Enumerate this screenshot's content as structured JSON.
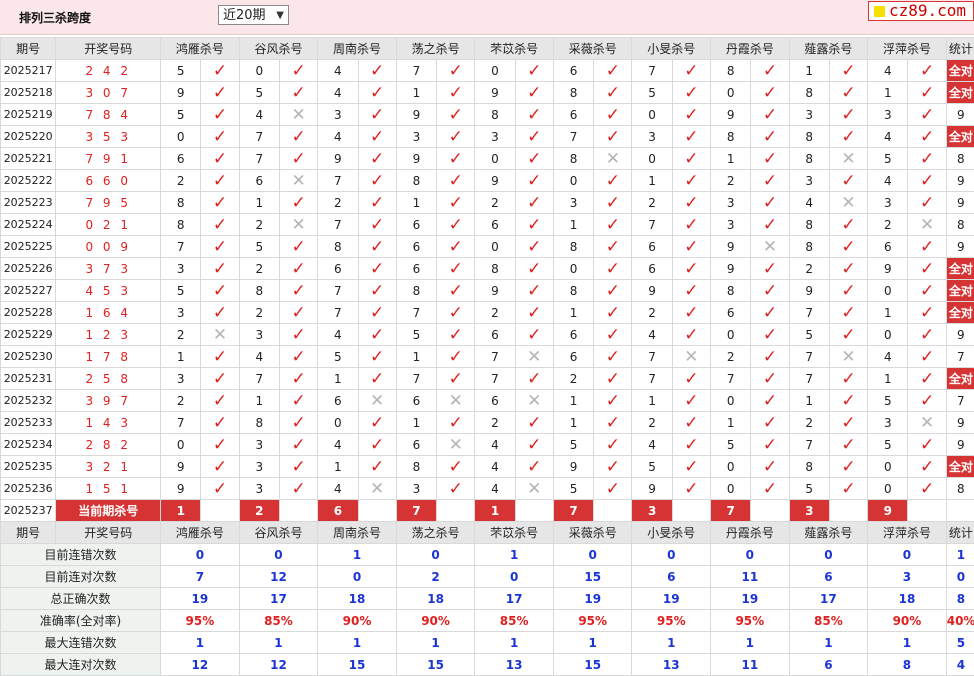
{
  "header": {
    "title": "排列三杀跨度",
    "period_select": "近20期",
    "logo_text": "cz89.com"
  },
  "columns": [
    "期号",
    "开奖号码",
    "鸿雁杀号",
    "谷风杀号",
    "周南杀号",
    "荡之杀号",
    "芣苡杀号",
    "采薇杀号",
    "小旻杀号",
    "丹霞杀号",
    "薤露杀号",
    "浮萍杀号",
    "统计"
  ],
  "rows": [
    {
      "q": "2025217",
      "n": "242",
      "v": [
        5,
        0,
        4,
        7,
        0,
        6,
        7,
        8,
        1,
        4
      ],
      "r": [
        1,
        1,
        1,
        1,
        1,
        1,
        1,
        1,
        1,
        1
      ],
      "s": "全对"
    },
    {
      "q": "2025218",
      "n": "307",
      "v": [
        9,
        5,
        4,
        1,
        9,
        8,
        5,
        0,
        8,
        1
      ],
      "r": [
        1,
        1,
        1,
        1,
        1,
        1,
        1,
        1,
        1,
        1
      ],
      "s": "全对"
    },
    {
      "q": "2025219",
      "n": "784",
      "v": [
        5,
        4,
        3,
        9,
        8,
        6,
        0,
        9,
        3,
        3
      ],
      "r": [
        1,
        0,
        1,
        1,
        1,
        1,
        1,
        1,
        1,
        1
      ],
      "s": "9"
    },
    {
      "q": "2025220",
      "n": "353",
      "v": [
        0,
        7,
        4,
        3,
        3,
        7,
        3,
        8,
        8,
        4
      ],
      "r": [
        1,
        1,
        1,
        1,
        1,
        1,
        1,
        1,
        1,
        1
      ],
      "s": "全对"
    },
    {
      "q": "2025221",
      "n": "791",
      "v": [
        6,
        7,
        9,
        9,
        0,
        8,
        0,
        1,
        8,
        5
      ],
      "r": [
        1,
        1,
        1,
        1,
        1,
        0,
        1,
        1,
        0,
        1
      ],
      "s": "8"
    },
    {
      "q": "2025222",
      "n": "660",
      "v": [
        2,
        6,
        7,
        8,
        9,
        0,
        1,
        2,
        3,
        4
      ],
      "r": [
        1,
        0,
        1,
        1,
        1,
        1,
        1,
        1,
        1,
        1
      ],
      "s": "9"
    },
    {
      "q": "2025223",
      "n": "795",
      "v": [
        8,
        1,
        2,
        1,
        2,
        3,
        2,
        3,
        4,
        3
      ],
      "r": [
        1,
        1,
        1,
        1,
        1,
        1,
        1,
        1,
        0,
        1
      ],
      "s": "9"
    },
    {
      "q": "2025224",
      "n": "021",
      "v": [
        8,
        2,
        7,
        6,
        6,
        1,
        7,
        3,
        8,
        2
      ],
      "r": [
        1,
        0,
        1,
        1,
        1,
        1,
        1,
        1,
        1,
        0
      ],
      "s": "8"
    },
    {
      "q": "2025225",
      "n": "009",
      "v": [
        7,
        5,
        8,
        6,
        0,
        8,
        6,
        9,
        8,
        6
      ],
      "r": [
        1,
        1,
        1,
        1,
        1,
        1,
        1,
        0,
        1,
        1
      ],
      "s": "9"
    },
    {
      "q": "2025226",
      "n": "373",
      "v": [
        3,
        2,
        6,
        6,
        8,
        0,
        6,
        9,
        2,
        9
      ],
      "r": [
        1,
        1,
        1,
        1,
        1,
        1,
        1,
        1,
        1,
        1
      ],
      "s": "全对"
    },
    {
      "q": "2025227",
      "n": "453",
      "v": [
        5,
        8,
        7,
        8,
        9,
        8,
        9,
        8,
        9,
        0
      ],
      "r": [
        1,
        1,
        1,
        1,
        1,
        1,
        1,
        1,
        1,
        1
      ],
      "s": "全对"
    },
    {
      "q": "2025228",
      "n": "164",
      "v": [
        3,
        2,
        7,
        7,
        2,
        1,
        2,
        6,
        7,
        1
      ],
      "r": [
        1,
        1,
        1,
        1,
        1,
        1,
        1,
        1,
        1,
        1
      ],
      "s": "全对"
    },
    {
      "q": "2025229",
      "n": "123",
      "v": [
        2,
        3,
        4,
        5,
        6,
        6,
        4,
        0,
        5,
        0
      ],
      "r": [
        0,
        1,
        1,
        1,
        1,
        1,
        1,
        1,
        1,
        1
      ],
      "s": "9"
    },
    {
      "q": "2025230",
      "n": "178",
      "v": [
        1,
        4,
        5,
        1,
        7,
        6,
        7,
        2,
        7,
        4
      ],
      "r": [
        1,
        1,
        1,
        1,
        0,
        1,
        0,
        1,
        0,
        1
      ],
      "s": "7"
    },
    {
      "q": "2025231",
      "n": "258",
      "v": [
        3,
        7,
        1,
        7,
        7,
        2,
        7,
        7,
        7,
        1
      ],
      "r": [
        1,
        1,
        1,
        1,
        1,
        1,
        1,
        1,
        1,
        1
      ],
      "s": "全对"
    },
    {
      "q": "2025232",
      "n": "397",
      "v": [
        2,
        1,
        6,
        6,
        6,
        1,
        1,
        0,
        1,
        5
      ],
      "r": [
        1,
        1,
        0,
        0,
        0,
        1,
        1,
        1,
        1,
        1
      ],
      "s": "7"
    },
    {
      "q": "2025233",
      "n": "143",
      "v": [
        7,
        8,
        0,
        1,
        2,
        1,
        2,
        1,
        2,
        3
      ],
      "r": [
        1,
        1,
        1,
        1,
        1,
        1,
        1,
        1,
        1,
        0
      ],
      "s": "9"
    },
    {
      "q": "2025234",
      "n": "282",
      "v": [
        0,
        3,
        4,
        6,
        4,
        5,
        4,
        5,
        7,
        5
      ],
      "r": [
        1,
        1,
        1,
        0,
        1,
        1,
        1,
        1,
        1,
        1
      ],
      "s": "9"
    },
    {
      "q": "2025235",
      "n": "321",
      "v": [
        9,
        3,
        1,
        8,
        4,
        9,
        5,
        0,
        8,
        0
      ],
      "r": [
        1,
        1,
        1,
        1,
        1,
        1,
        1,
        1,
        1,
        1
      ],
      "s": "全对"
    },
    {
      "q": "2025236",
      "n": "151",
      "v": [
        9,
        3,
        4,
        3,
        4,
        5,
        9,
        0,
        5,
        0
      ],
      "r": [
        1,
        1,
        0,
        1,
        0,
        1,
        1,
        1,
        1,
        1
      ],
      "s": "8"
    }
  ],
  "current": {
    "q": "2025237",
    "label": "当前期杀号",
    "v": [
      1,
      2,
      6,
      7,
      1,
      7,
      3,
      7,
      3,
      9
    ]
  },
  "stats": [
    {
      "label": "目前连错次数",
      "v": [
        "0",
        "0",
        "1",
        "0",
        "1",
        "0",
        "0",
        "0",
        "0",
        "0"
      ],
      "s": "1",
      "red": false
    },
    {
      "label": "目前连对次数",
      "v": [
        "7",
        "12",
        "0",
        "2",
        "0",
        "15",
        "6",
        "11",
        "6",
        "3"
      ],
      "s": "0",
      "red": false
    },
    {
      "label": "总正确次数",
      "v": [
        "19",
        "17",
        "18",
        "18",
        "17",
        "19",
        "19",
        "19",
        "17",
        "18"
      ],
      "s": "8",
      "red": false
    },
    {
      "label": "准确率(全对率)",
      "v": [
        "95%",
        "85%",
        "90%",
        "90%",
        "85%",
        "95%",
        "95%",
        "95%",
        "85%",
        "90%"
      ],
      "s": "40%",
      "red": true
    },
    {
      "label": "最大连错次数",
      "v": [
        "1",
        "1",
        "1",
        "1",
        "1",
        "1",
        "1",
        "1",
        "1",
        "1"
      ],
      "s": "5",
      "red": false
    },
    {
      "label": "最大连对次数",
      "v": [
        "12",
        "12",
        "15",
        "15",
        "13",
        "15",
        "13",
        "11",
        "6",
        "8"
      ],
      "s": "4",
      "red": false
    }
  ]
}
